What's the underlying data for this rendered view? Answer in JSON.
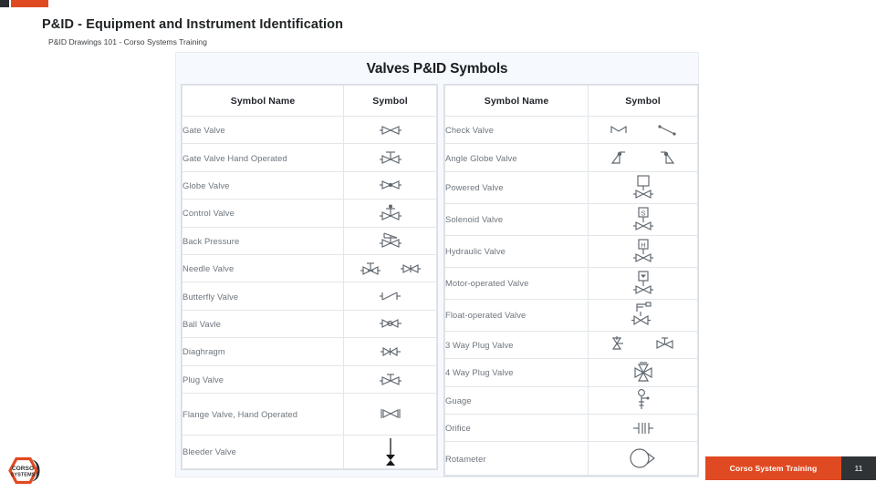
{
  "deco": {
    "dark_color": "#2b2f33",
    "orange_color": "#e04a22"
  },
  "header": {
    "title": "P&ID - Equipment and Instrument Identification",
    "subtitle": "P&ID Drawings 101 - Corso Systems Training"
  },
  "panel": {
    "title": "Valves P&ID Symbols",
    "background": "#f6f9fd"
  },
  "columns": {
    "name": "Symbol Name",
    "symbol": "Symbol"
  },
  "left_table": {
    "headers": [
      "Symbol Name",
      "Symbol"
    ],
    "rows": [
      {
        "name": "Gate Valve",
        "symbol": "gate-valve-symbol"
      },
      {
        "name": "Gate Valve Hand Operated",
        "symbol": "gate-valve-hand-operated-symbol"
      },
      {
        "name": "Globe Valve",
        "symbol": "globe-valve-symbol"
      },
      {
        "name": "Control Valve",
        "symbol": "control-valve-symbol"
      },
      {
        "name": "Back Pressure",
        "symbol": "back-pressure-valve-symbol"
      },
      {
        "name": "Needle Valve",
        "symbol": "needle-valve-symbol"
      },
      {
        "name": "Butterfly Valve",
        "symbol": "butterfly-valve-symbol"
      },
      {
        "name": "Ball Vavle",
        "symbol": "ball-valve-symbol"
      },
      {
        "name": "Diaghragm",
        "symbol": "diaphragm-valve-symbol"
      },
      {
        "name": "Plug Valve",
        "symbol": "plug-valve-symbol"
      },
      {
        "name": "Flange Valve, Hand Operated",
        "symbol": "flange-valve-hand-operated-symbol"
      },
      {
        "name": "Bleeder Valve",
        "symbol": "bleeder-valve-symbol"
      }
    ]
  },
  "right_table": {
    "headers": [
      "Symbol Name",
      "Symbol"
    ],
    "rows": [
      {
        "name": "Check Valve",
        "symbol": "check-valve-symbol"
      },
      {
        "name": "Angle Globe Valve",
        "symbol": "angle-globe-valve-symbol"
      },
      {
        "name": "Powered Valve",
        "symbol": "powered-valve-symbol"
      },
      {
        "name": "Solenoid Valve",
        "symbol": "solenoid-valve-symbol",
        "actuator_label": "S"
      },
      {
        "name": "Hydraulic Valve",
        "symbol": "hydraulic-valve-symbol",
        "actuator_label": "H"
      },
      {
        "name": "Motor-operated Valve",
        "symbol": "motor-operated-valve-symbol"
      },
      {
        "name": "Float-operated Valve",
        "symbol": "float-operated-valve-symbol"
      },
      {
        "name": "3 Way Plug Valve",
        "symbol": "three-way-plug-valve-symbol"
      },
      {
        "name": "4 Way Plug Valve",
        "symbol": "four-way-plug-valve-symbol"
      },
      {
        "name": "Guage",
        "symbol": "gauge-symbol"
      },
      {
        "name": "Orifice",
        "symbol": "orifice-symbol"
      },
      {
        "name": "Rotameter",
        "symbol": "rotameter-symbol"
      }
    ]
  },
  "footer": {
    "label": "Corso System Training",
    "page_number": "11",
    "bar_color": "#e04a22",
    "page_bg_color": "#2f3336"
  },
  "logo": {
    "line1": "CORSO",
    "line2": "SYSTEMS",
    "hex_color": "#e04a22",
    "crescent_color": "#2b2f33"
  }
}
